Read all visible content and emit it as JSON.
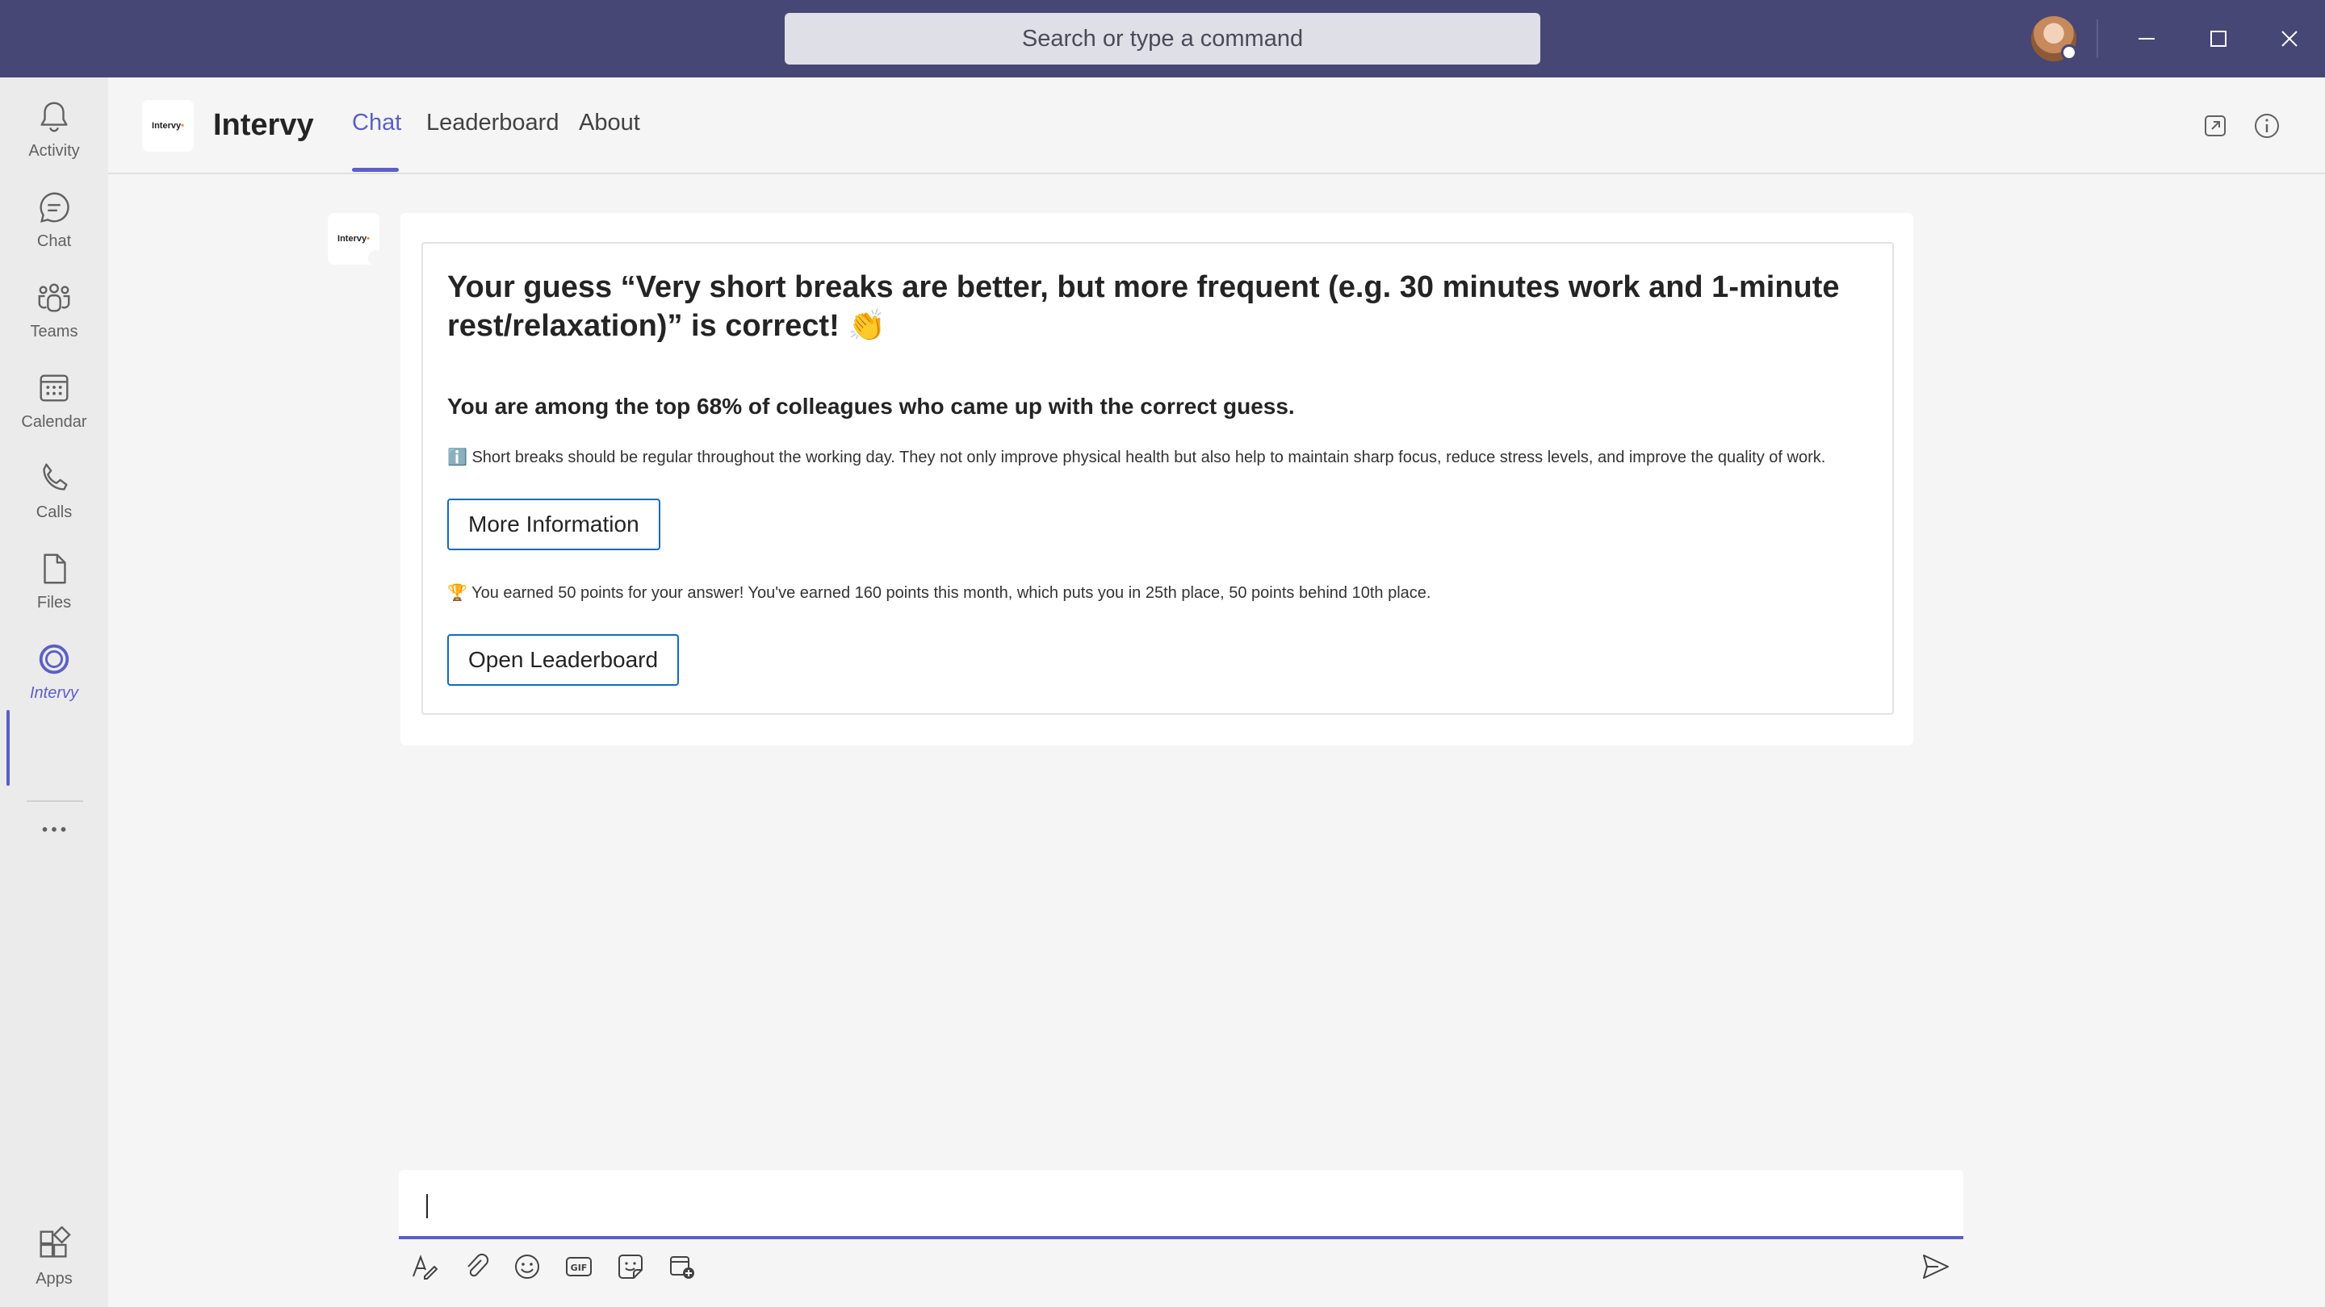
{
  "titlebar": {
    "search_placeholder": "Search or type a command",
    "color": "#464775"
  },
  "rail": {
    "items": [
      {
        "label": "Activity",
        "icon": "bell-icon"
      },
      {
        "label": "Chat",
        "icon": "chat-icon"
      },
      {
        "label": "Teams",
        "icon": "teams-icon"
      },
      {
        "label": "Calendar",
        "icon": "calendar-icon"
      },
      {
        "label": "Calls",
        "icon": "phone-icon"
      },
      {
        "label": "Files",
        "icon": "file-icon"
      },
      {
        "label": "Intervy",
        "icon": "intervy-app-icon",
        "active": true
      }
    ],
    "more_icon": "more-icon",
    "apps": {
      "label": "Apps",
      "icon": "apps-icon"
    }
  },
  "header": {
    "logo_text": "Intervy",
    "app_name": "Intervy",
    "tabs": [
      {
        "label": "Chat",
        "active": true
      },
      {
        "label": "Leaderboard"
      },
      {
        "label": "About"
      }
    ]
  },
  "message": {
    "bot_logo_text": "Intervy",
    "card": {
      "title": "Your guess “Very short breaks are better, but more frequent (e.g. 30 minutes work and 1-minute rest/relaxation)” is correct! 👏",
      "subtitle": "You are among the top 68% of colleagues who came up with the correct guess.",
      "info": "ℹ️ Short breaks should be regular throughout the working day. They not only improve physical health but also help to maintain sharp focus, reduce stress levels, and improve the quality of work.",
      "more_info_button": "More Information",
      "points": "🏆 You earned 50 points for your answer! You've earned 160 points this month, which puts you in 25th place, 50 points behind 10th place.",
      "leaderboard_button": "Open Leaderboard"
    }
  },
  "compose": {
    "tools": [
      "format-icon",
      "attach-icon",
      "emoji-icon",
      "gif-icon",
      "sticker-icon",
      "schedule-meeting-icon"
    ],
    "send_icon": "send-icon"
  },
  "colors": {
    "accent": "#5b5fc7",
    "button_border": "#0f6cbd"
  }
}
